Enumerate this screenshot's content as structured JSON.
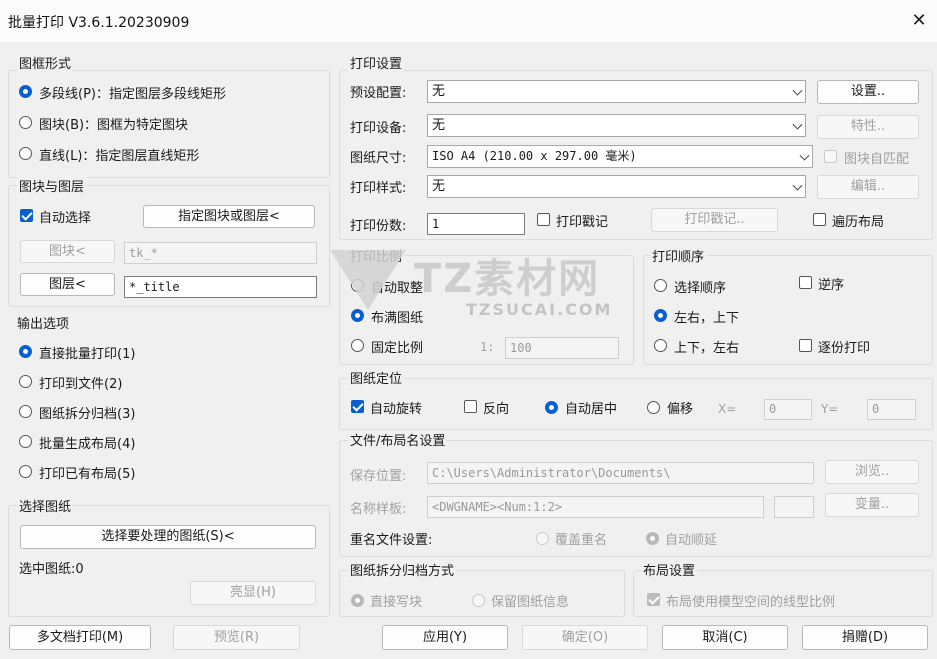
{
  "window": {
    "title": "批量打印 V3.6.1.20230909",
    "close_glyph": "✕"
  },
  "frame_form": {
    "title": "图框形式",
    "options": [
      "多段线(P)：指定图层多段线矩形",
      "图块(B)：图框为特定图块",
      "直线(L)：指定图层直线矩形"
    ],
    "selected": 0
  },
  "block_layer": {
    "title": "图块与图层",
    "auto_select_label": "自动选择",
    "auto_select_checked": true,
    "specify_button": "指定图块或图层<",
    "block_button": "图块<",
    "block_value": "tk_*",
    "layer_button": "图层<",
    "layer_value": "*_title"
  },
  "output": {
    "title": "输出选项",
    "options": [
      "直接批量打印(1)",
      "打印到文件(2)",
      "图纸拆分归档(3)",
      "批量生成布局(4)",
      "打印已有布局(5)"
    ],
    "selected": 0
  },
  "select_drawing": {
    "title": "选择图纸",
    "select_button": "选择要处理的图纸(S)<",
    "selected_label": "选中图纸:0",
    "highlight_button": "亮显(H)"
  },
  "print_settings": {
    "title": "打印设置",
    "preset_label": "预设配置:",
    "preset_value": "无",
    "setup_button": "设置..",
    "device_label": "打印设备:",
    "device_value": "无",
    "properties_button": "特性..",
    "paper_label": "图纸尺寸:",
    "paper_value": "ISO A4 (210.00 x 297.00 毫米)",
    "block_auto_fit_label": "图块自匹配",
    "style_label": "打印样式:",
    "style_value": "无",
    "edit_button": "编辑..",
    "copies_label": "打印份数:",
    "copies_value": "1",
    "stamp_label": "打印戳记",
    "stamp_button": "打印戳记..",
    "traverse_label": "遍历布局"
  },
  "scale": {
    "title": "打印比例",
    "options": [
      "自动取整",
      "布满图纸",
      "固定比例"
    ],
    "selected": 1,
    "ratio_prefix": "1:",
    "ratio_value": "100"
  },
  "order": {
    "title": "打印顺序",
    "options": [
      "选择顺序",
      "左右，上下",
      "上下，左右"
    ],
    "selected": 1,
    "reverse_label": "逆序",
    "collate_label": "逐份打印"
  },
  "position": {
    "title": "图纸定位",
    "auto_rotate_label": "自动旋转",
    "auto_rotate_checked": true,
    "reverse_label": "反向",
    "center_label": "自动居中",
    "offset_label": "偏移",
    "x_label": "X=",
    "x_value": "0",
    "y_label": "Y=",
    "y_value": "0"
  },
  "filename": {
    "title": "文件/布局名设置",
    "save_label": "保存位置:",
    "save_value": "C:\\Users\\Administrator\\Documents\\",
    "browse_button": "浏览..",
    "template_label": "名称样板:",
    "template_value": "<DWGNAME><Num:1:2>",
    "variable_button": "变量..",
    "rename_label": "重名文件设置:",
    "overwrite_label": "覆盖重名",
    "auto_continue_label": "自动顺延"
  },
  "archive": {
    "title": "图纸拆分归档方式",
    "direct_label": "直接写块",
    "keep_label": "保留图纸信息"
  },
  "layout": {
    "title": "布局设置",
    "linetype_label": "布局使用模型空间的线型比例"
  },
  "footer": {
    "multi_doc_button": "多文档打印(M)",
    "preview_button": "预览(R)",
    "apply_button": "应用(Y)",
    "ok_button": "确定(O)",
    "cancel_button": "取消(C)",
    "donate_button": "捐赠(D)"
  },
  "watermark": {
    "main": "TZ素材网",
    "sub": "TZSUCAI.COM"
  }
}
